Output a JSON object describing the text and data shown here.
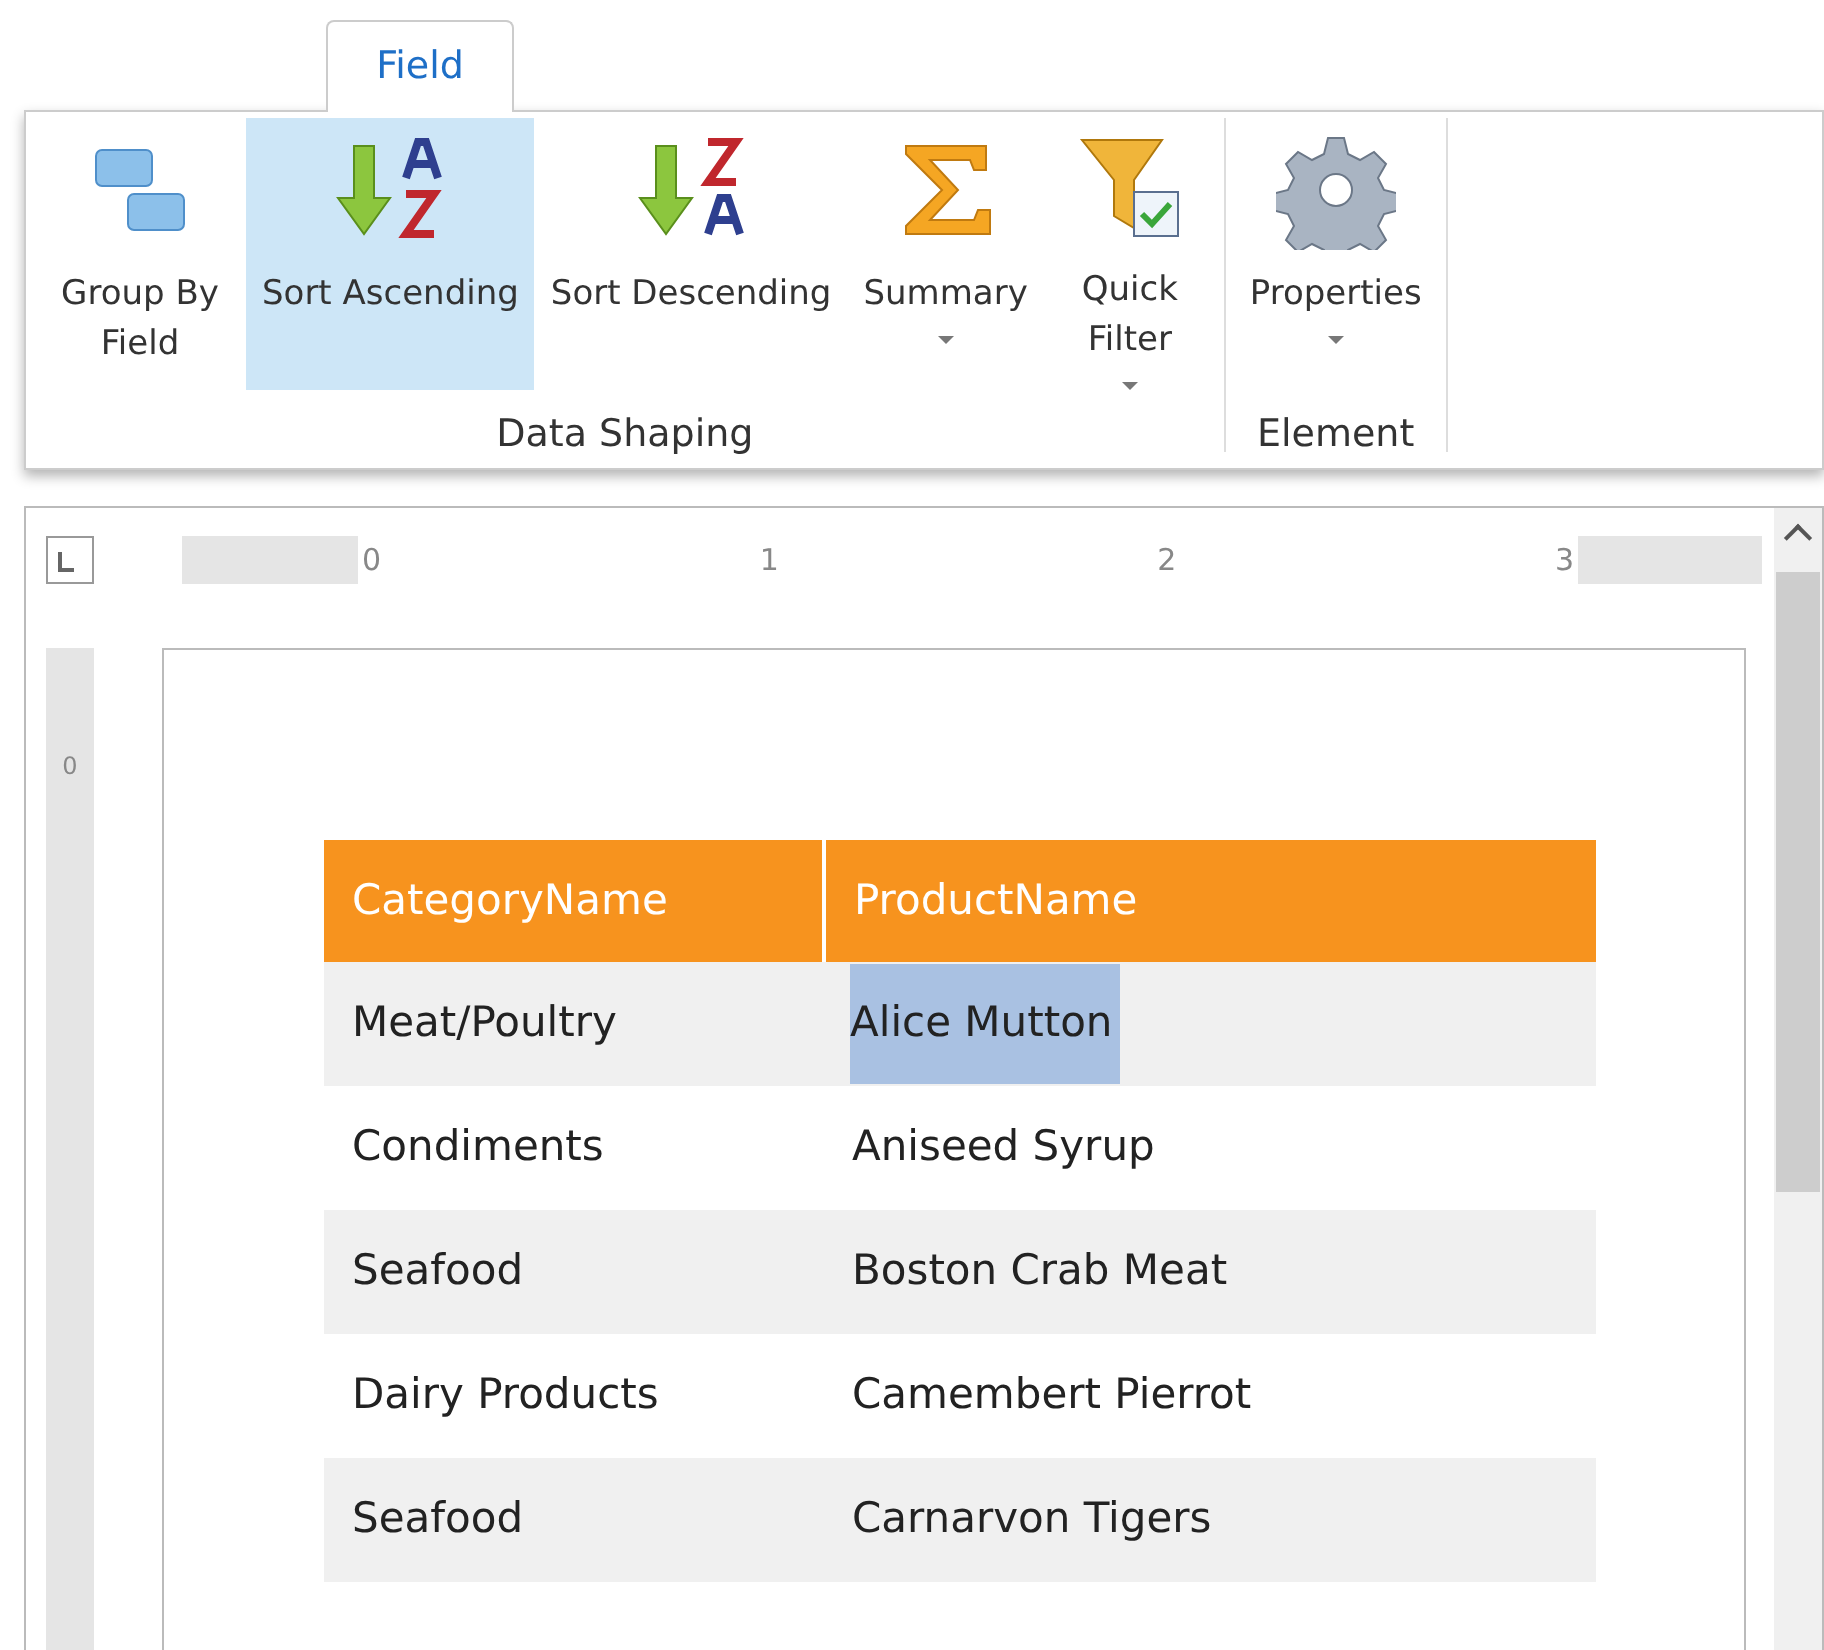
{
  "ribbon": {
    "tabs": [
      {
        "label": "Field",
        "selected": true
      }
    ],
    "groups": [
      {
        "label": "Data Shaping",
        "buttons": [
          {
            "kind": "group",
            "label": "Group By Field",
            "dropdown": false,
            "selected": false
          },
          {
            "kind": "sort-asc",
            "label": "Sort Ascending",
            "dropdown": false,
            "selected": true
          },
          {
            "kind": "sort-desc",
            "label": "Sort Descending",
            "dropdown": false,
            "selected": false
          },
          {
            "kind": "summary",
            "label": "Summary",
            "dropdown": true,
            "selected": false
          },
          {
            "kind": "filter",
            "label": "Quick Filter",
            "dropdown": true,
            "selected": false
          }
        ]
      },
      {
        "label": "Element",
        "buttons": [
          {
            "kind": "gear",
            "label": "Properties",
            "dropdown": true,
            "selected": false
          }
        ]
      }
    ]
  },
  "ruler": {
    "numbers": [
      "0",
      "1",
      "2",
      "3"
    ],
    "vertical_number": "0"
  },
  "table": {
    "columns": [
      "CategoryName",
      "ProductName"
    ],
    "rows": [
      {
        "cells": [
          {
            "text": "Meat/Poultry",
            "selected": false
          },
          {
            "text": "Alice Mutton",
            "selected": true
          }
        ]
      },
      {
        "cells": [
          {
            "text": "Condiments",
            "selected": false
          },
          {
            "text": "Aniseed Syrup",
            "selected": false
          }
        ]
      },
      {
        "cells": [
          {
            "text": "Seafood",
            "selected": false
          },
          {
            "text": "Boston Crab Meat",
            "selected": false
          }
        ]
      },
      {
        "cells": [
          {
            "text": "Dairy Products",
            "selected": false
          },
          {
            "text": "Camembert Pierrot",
            "selected": false
          }
        ]
      },
      {
        "cells": [
          {
            "text": "Seafood",
            "selected": false
          },
          {
            "text": "Carnarvon Tigers",
            "selected": false
          }
        ]
      }
    ]
  }
}
